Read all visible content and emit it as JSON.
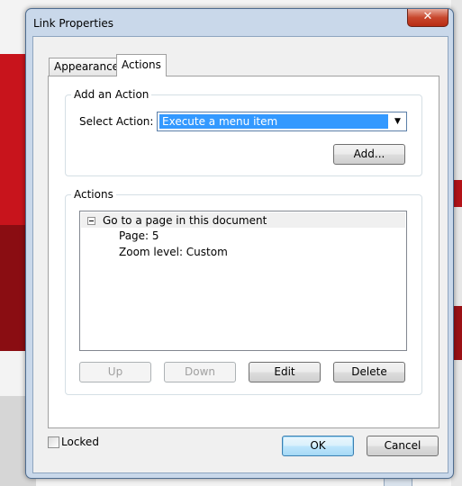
{
  "window": {
    "title": "Link Properties",
    "close_glyph": "✕"
  },
  "tabs": [
    {
      "label": "Appearance",
      "selected": false
    },
    {
      "label": "Actions",
      "selected": true
    }
  ],
  "add_action": {
    "group_label": "Add an Action",
    "select_label": "Select Action:",
    "selected_value": "Execute a menu item",
    "add_button": "Add..."
  },
  "actions": {
    "group_label": "Actions",
    "tree": {
      "root": "Go to a page in this document",
      "children": [
        "Page: 5",
        "Zoom level: Custom"
      ]
    },
    "buttons": {
      "up": "Up",
      "down": "Down",
      "edit": "Edit",
      "delete": "Delete"
    }
  },
  "footer": {
    "locked_label": "Locked",
    "locked_checked": false,
    "ok": "OK",
    "cancel": "Cancel"
  },
  "colors": {
    "selection": "#3399ff",
    "close_button": "#c8472d",
    "window_frame": "#c9d8ea"
  }
}
